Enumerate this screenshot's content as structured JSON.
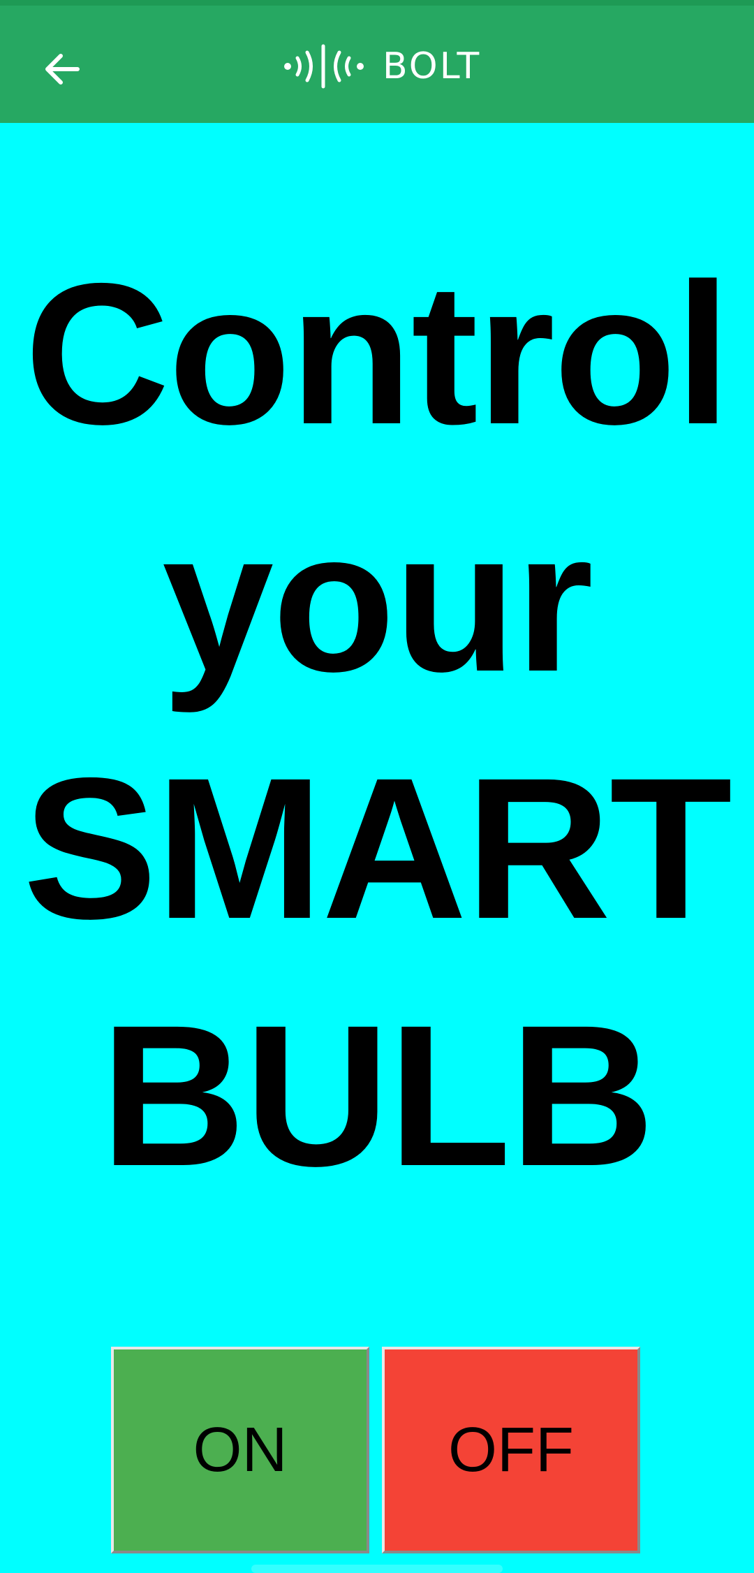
{
  "app_bar": {
    "back_icon": "arrow-left-icon",
    "logo_icon": "bolt-signal-icon",
    "logo_text": "BOLT",
    "background_color": "#26A862"
  },
  "page": {
    "background_color": "#00FFFF",
    "headline_lines": [
      "Control",
      "your",
      "SMART",
      "BULB"
    ]
  },
  "controls": {
    "on_label": "ON",
    "off_label": "OFF",
    "on_color": "#4CAF50",
    "off_color": "#F44336"
  }
}
